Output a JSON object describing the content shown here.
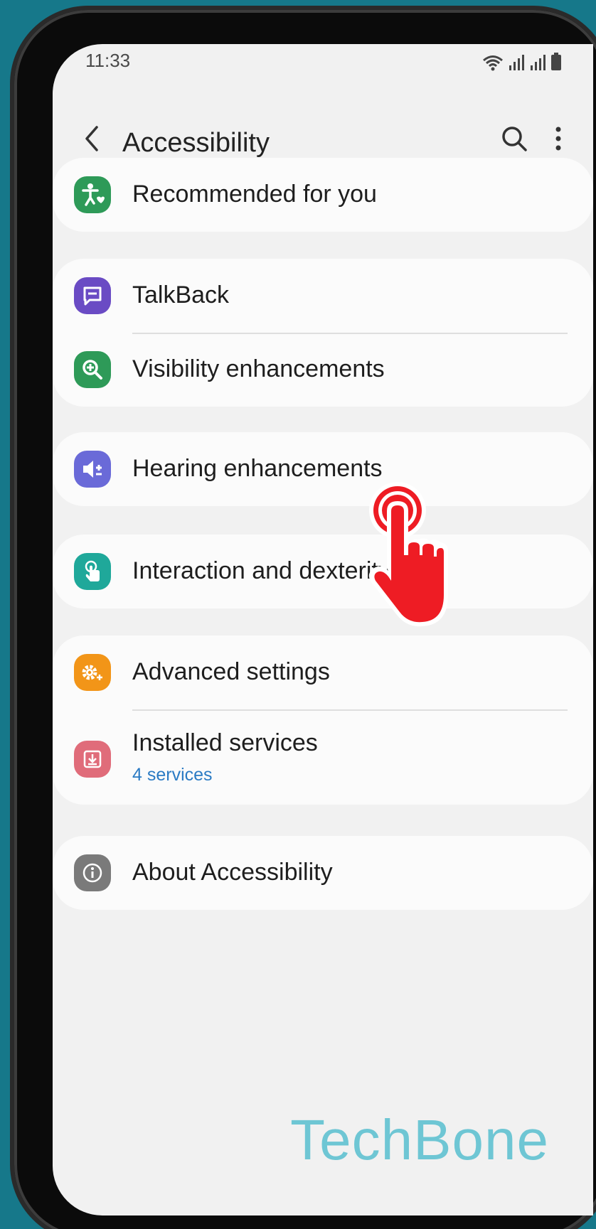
{
  "status_bar": {
    "time": "11:33"
  },
  "app_bar": {
    "title": "Accessibility"
  },
  "groups": [
    {
      "items": [
        {
          "label": "Recommended for you",
          "icon": "accessibility-person-icon",
          "color": "#2e9a58"
        }
      ]
    },
    {
      "items": [
        {
          "label": "TalkBack",
          "icon": "talkback-bubble-icon",
          "color": "#6a4bc4"
        },
        {
          "label": "Visibility enhancements",
          "icon": "magnifier-plus-icon",
          "color": "#2e9a58"
        }
      ]
    },
    {
      "items": [
        {
          "label": "Hearing enhancements",
          "icon": "speaker-plus-icon",
          "color": "#6a6ad8"
        }
      ]
    },
    {
      "items": [
        {
          "label": "Interaction and dexterity",
          "icon": "touch-hand-icon",
          "color": "#1fa89a"
        }
      ]
    },
    {
      "items": [
        {
          "label": "Advanced settings",
          "icon": "gear-plus-icon",
          "color": "#f29518"
        },
        {
          "label": "Installed services",
          "sublabel": "4 services",
          "icon": "download-box-icon",
          "color": "#e06c7a"
        }
      ]
    },
    {
      "items": [
        {
          "label": "About Accessibility",
          "icon": "info-icon",
          "color": "#7a7a7a"
        }
      ]
    }
  ],
  "watermark": "TechBone",
  "colors": {
    "background": "#16788a",
    "screen": "#f1f1f1",
    "card": "#fbfbfb",
    "tap_indicator": "#ee1c24",
    "link": "#2b7bc4"
  }
}
